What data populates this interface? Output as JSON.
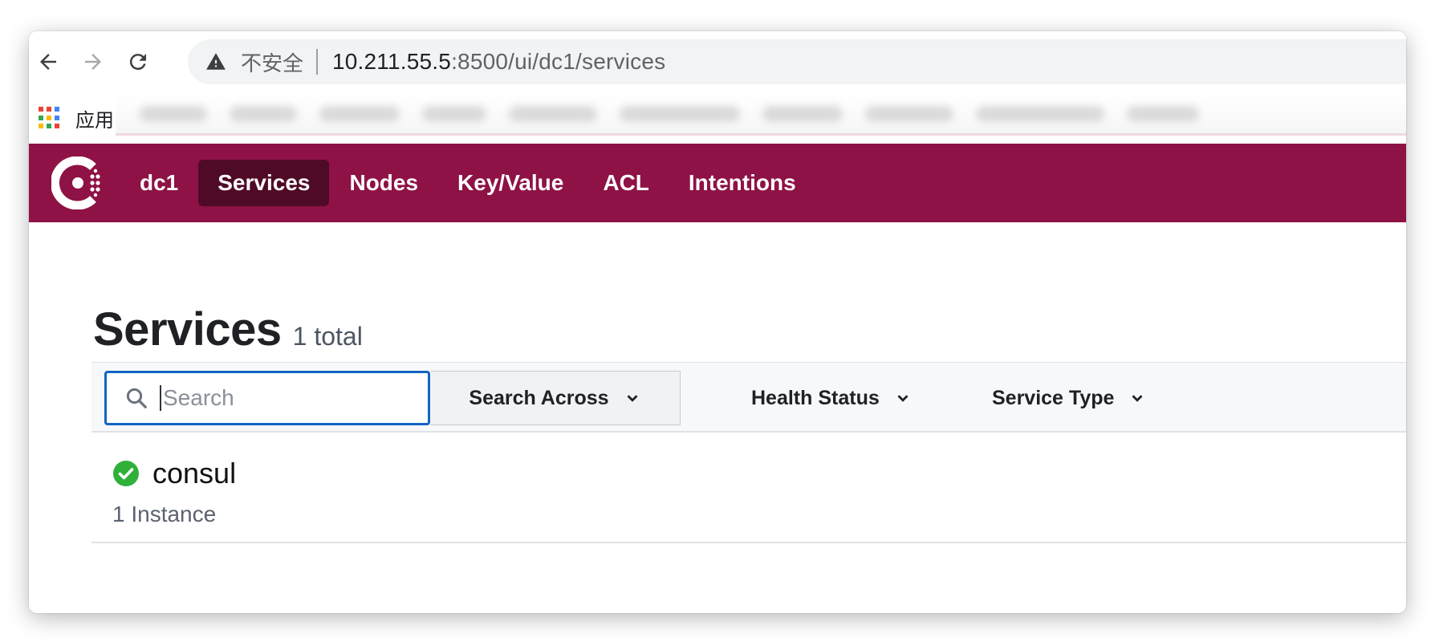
{
  "browser": {
    "insecure_label": "不安全",
    "url_host": "10.211.55.5",
    "url_rest": ":8500/ui/dc1/services",
    "bookmarks_apps_label": "应用"
  },
  "colors": {
    "brand": "#8e1245",
    "brand_active": "#4f0a27",
    "focus": "#1563c4",
    "health_passing": "#2eb039"
  },
  "nav": {
    "datacenter": "dc1",
    "items": [
      {
        "label": "Services",
        "active": true
      },
      {
        "label": "Nodes",
        "active": false
      },
      {
        "label": "Key/Value",
        "active": false
      },
      {
        "label": "ACL",
        "active": false
      },
      {
        "label": "Intentions",
        "active": false
      }
    ]
  },
  "page": {
    "title": "Services",
    "count": "1 total"
  },
  "filters": {
    "search_placeholder": "Search",
    "search_value": "",
    "search_across": "Search Across",
    "health_status": "Health Status",
    "service_type": "Service Type"
  },
  "services": [
    {
      "name": "consul",
      "instances": "1 Instance",
      "health": "passing",
      "icon": "check-circle-icon"
    }
  ]
}
